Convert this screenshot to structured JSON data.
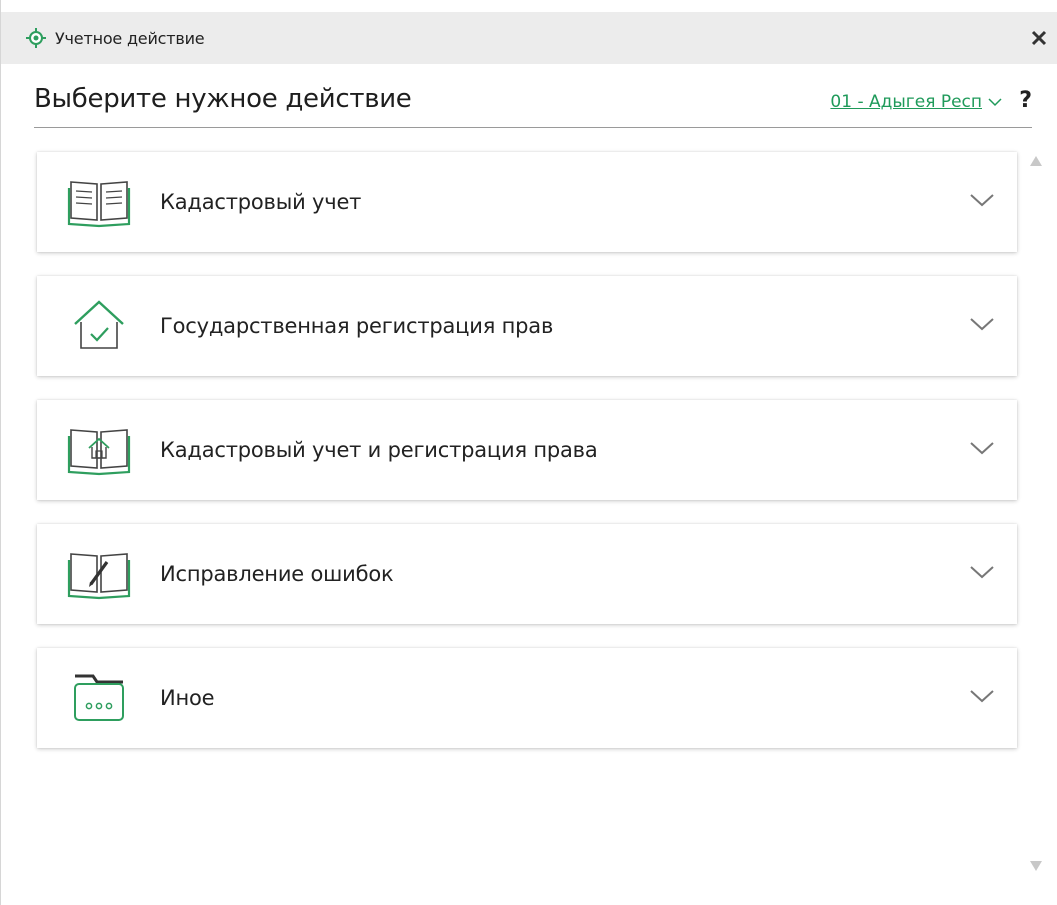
{
  "window": {
    "title": "Учетное действие",
    "app_icon": "crosshair-icon",
    "close_icon": "close-icon"
  },
  "header": {
    "heading": "Выберите нужное действие",
    "region": "01 - Адыгея Респ",
    "help": "?"
  },
  "colors": {
    "accent": "#1f9a5a",
    "icon_green": "#2e9e5e",
    "titlebar_bg": "#ececec"
  },
  "actions": [
    {
      "label": "Кадастровый учет",
      "icon": "open-book-icon"
    },
    {
      "label": "Государственная регистрация прав",
      "icon": "house-check-icon"
    },
    {
      "label": "Кадастровый учет и регистрация права",
      "icon": "book-house-icon"
    },
    {
      "label": "Исправление ошибок",
      "icon": "book-pen-icon"
    },
    {
      "label": "Иное",
      "icon": "folder-dots-icon"
    }
  ]
}
